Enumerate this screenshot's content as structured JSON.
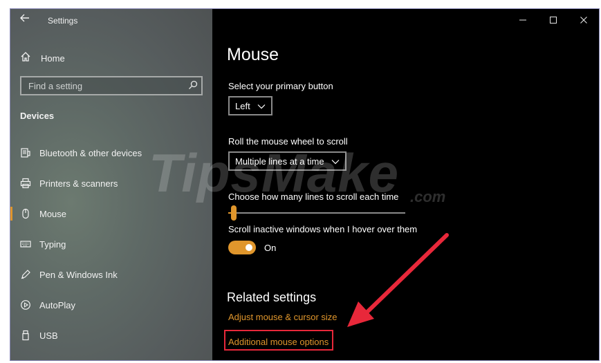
{
  "window": {
    "title": "Settings"
  },
  "sidebar": {
    "home_label": "Home",
    "search_placeholder": "Find a setting",
    "section_title": "Devices",
    "items": [
      {
        "label": "Bluetooth & other devices",
        "icon": "bluetooth-devices-icon"
      },
      {
        "label": "Printers & scanners",
        "icon": "printer-icon"
      },
      {
        "label": "Mouse",
        "icon": "mouse-icon",
        "selected": true
      },
      {
        "label": "Typing",
        "icon": "keyboard-icon"
      },
      {
        "label": "Pen & Windows Ink",
        "icon": "pen-icon"
      },
      {
        "label": "AutoPlay",
        "icon": "autoplay-icon"
      },
      {
        "label": "USB",
        "icon": "usb-icon"
      }
    ]
  },
  "main": {
    "title": "Mouse",
    "primary_button": {
      "label": "Select your primary button",
      "value": "Left"
    },
    "wheel": {
      "label": "Roll the mouse wheel to scroll",
      "value": "Multiple lines at a time"
    },
    "lines": {
      "label": "Choose how many lines to scroll each time",
      "value_fraction": 0.03
    },
    "inactive_scroll": {
      "label": "Scroll inactive windows when I hover over them",
      "state": "On",
      "on": true
    },
    "related": {
      "title": "Related settings",
      "links": [
        "Adjust mouse & cursor size",
        "Additional mouse options"
      ]
    }
  },
  "watermark": {
    "main": "TipsMake",
    "suffix": ".com"
  },
  "colors": {
    "accent": "#e0962c",
    "annotation": "#e8283a",
    "background": "#000000"
  }
}
